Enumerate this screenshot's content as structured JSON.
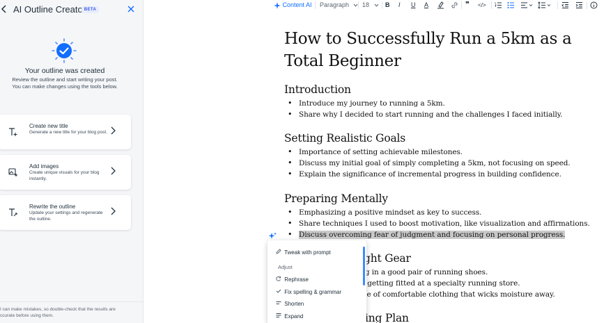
{
  "panel": {
    "back_icon": "chevron-left-icon",
    "title": "AI Outline Creator",
    "badge": "BETA",
    "close_icon": "close-icon",
    "success_icon": "checkmark-badge-icon",
    "created_title": "Your outline was created",
    "created_sub_line1": "Review the outline and start writing your post.",
    "created_sub_line2": "You can make changes using the tools below.",
    "cards": [
      {
        "icon": "text-add-icon",
        "title": "Create new title",
        "desc": "Generate a new title for your blog post."
      },
      {
        "icon": "image-add-icon",
        "title": "Add images",
        "desc": "Create unique visuals for your blog instantly."
      },
      {
        "icon": "text-rewrite-icon",
        "title": "Rewrite the outline",
        "desc": "Update your settings and regenerate the outline."
      }
    ],
    "disclaimer_line1": "I can make mistakes, so double-check that the results are",
    "disclaimer_line2": "ccurate before using them."
  },
  "toolbar": {
    "content_ai": "Content AI",
    "paragraph": "Paragraph",
    "font_size": "18",
    "bold": "B",
    "italic": "I",
    "underline": "U",
    "text_color": "A",
    "highlight_icon": "highlighter-icon",
    "link_icon": "link-icon",
    "quote": "❞",
    "code": "</>",
    "numbered_list_icon": "numbered-list-icon",
    "bullet_list_icon": "bullet-list-icon",
    "align_icon": "align-left-icon",
    "line_height_icon": "line-height-icon",
    "indent_decrease_icon": "indent-decrease-icon",
    "indent_increase_icon": "indent-increase-icon",
    "info_icon": "info-icon"
  },
  "doc": {
    "title": "How to Successfully Run a 5km as a Total Beginner",
    "sections": [
      {
        "heading": "Introduction",
        "bullets": [
          "Introduce my journey to running a 5km.",
          "Share why I decided to start running and the challenges I faced initially."
        ]
      },
      {
        "heading": "Setting Realistic Goals",
        "bullets": [
          "Importance of setting achievable milestones.",
          "Discuss my initial goal of simply completing a 5km, not focusing on speed.",
          "Explain the significance of incremental progress in building confidence."
        ]
      },
      {
        "heading": "Preparing Mentally",
        "bullets": [
          "Emphasizing a positive mindset as key to success.",
          "Share techniques I used to boost motivation, like visualization and affirmations.",
          "Discuss overcoming fear of judgment and focusing on personal progress."
        ]
      },
      {
        "heading": "ght Gear",
        "bullets": [
          "ing in a good pair of running shoes.",
          "of getting fitted at a specialty running store.",
          "nce of comfortable clothing that wicks moisture away."
        ]
      },
      {
        "heading": "ing Plan",
        "bullets": []
      }
    ]
  },
  "ai_menu": {
    "tweak": "Tweak with prompt",
    "adjust_label": "Adjust",
    "rephrase": "Rephrase",
    "fix": "Fix spelling & grammar",
    "shorten": "Shorten",
    "expand": "Expand",
    "tweak_icon": "pencil-icon",
    "rephrase_icon": "refresh-icon",
    "fix_icon": "check-icon",
    "shorten_icon": "shorten-icon",
    "expand_icon": "expand-icon"
  },
  "colors": {
    "accent": "#116dff",
    "selection": "#c9c9c9",
    "panel_bg": "#f5f6f8"
  }
}
